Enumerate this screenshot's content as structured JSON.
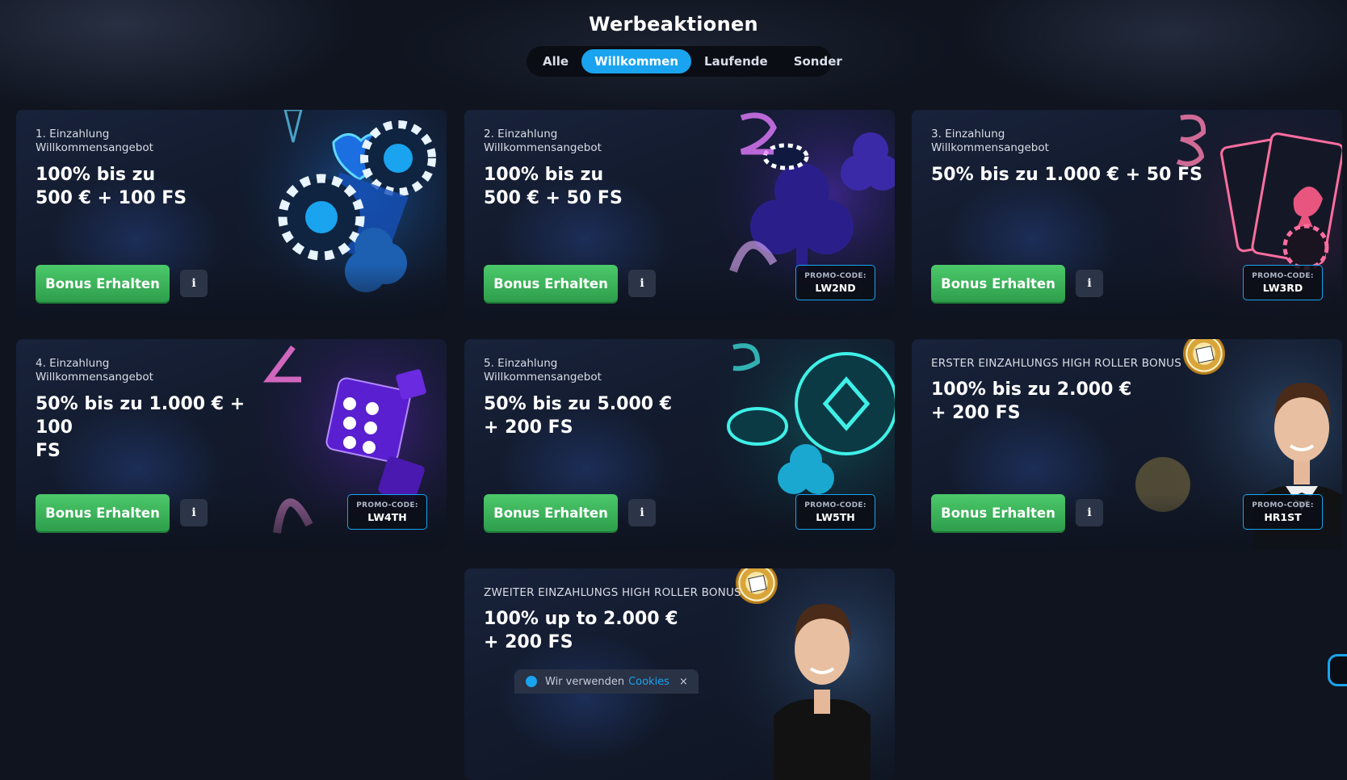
{
  "page": {
    "title": "Werbeaktionen"
  },
  "tabs": [
    {
      "label": "Alle",
      "active": false
    },
    {
      "label": "Willkommen",
      "active": true
    },
    {
      "label": "Laufende",
      "active": false
    },
    {
      "label": "Sonder",
      "active": false
    }
  ],
  "colors": {
    "accent": "#1aa3ee",
    "button_green": "#3fb95d",
    "background": "#0f141f",
    "card": "#151d30"
  },
  "cards": [
    {
      "sub": "1. Einzahlung\nWillkommensangebot",
      "headline": "100% bis zu\n500 € + 100 FS",
      "button": "Bonus Erhalten",
      "info": "i",
      "promo_label": "",
      "promo_code": ""
    },
    {
      "sub": "2. Einzahlung\nWillkommensangebot",
      "headline": "100% bis zu\n500 € + 50 FS",
      "button": "Bonus Erhalten",
      "info": "i",
      "promo_label": "PROMO-CODE:",
      "promo_code": "LW2ND"
    },
    {
      "sub": "3. Einzahlung\nWillkommensangebot",
      "headline": "50% bis zu 1.000 € + 50 FS",
      "button": "Bonus Erhalten",
      "info": "i",
      "promo_label": "PROMO-CODE:",
      "promo_code": "LW3RD"
    },
    {
      "sub": "4. Einzahlung\nWillkommensangebot",
      "headline": "50% bis zu 1.000 € + 100\nFS",
      "button": "Bonus Erhalten",
      "info": "i",
      "promo_label": "PROMO-CODE:",
      "promo_code": "LW4TH"
    },
    {
      "sub": "5. Einzahlung\nWillkommensangebot",
      "headline": "50% bis zu 5.000 €\n+ 200 FS",
      "button": "Bonus Erhalten",
      "info": "i",
      "promo_label": "PROMO-CODE:",
      "promo_code": "LW5TH"
    },
    {
      "sub": "ERSTER EINZAHLUNGS HIGH ROLLER BONUS",
      "headline": "100% bis zu 2.000 €\n+ 200 FS",
      "button": "Bonus Erhalten",
      "info": "i",
      "promo_label": "PROMO-CODE:",
      "promo_code": "HR1ST"
    },
    {
      "sub": "ZWEITER EINZAHLUNGS HIGH ROLLER BONUS",
      "headline": "100% up to 2.000 €\n+ 200 FS"
    }
  ],
  "cookie": {
    "text": "Wir verwenden",
    "link": "Cookies",
    "close": "×"
  },
  "icons": {
    "info": "info-icon",
    "chip": "vip-chip-icon",
    "support": "chat-support-icon"
  }
}
